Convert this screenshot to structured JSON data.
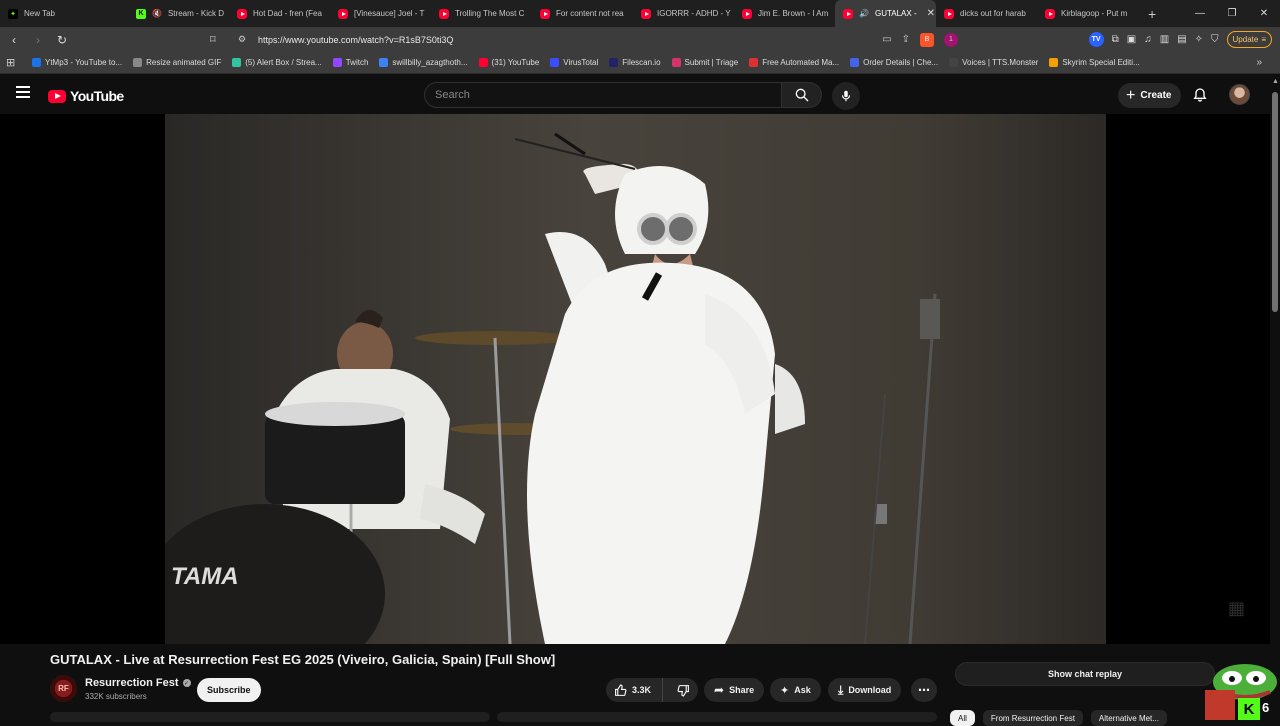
{
  "browser": {
    "tabs": [
      {
        "label": "New Tab",
        "favicon": "brave"
      },
      {
        "label": "Stream - Kick D",
        "favicon": "kick",
        "muted": true
      },
      {
        "label": "Hot Dad - fren (Fea",
        "favicon": "youtube"
      },
      {
        "label": "[Vinesauce] Joel - T",
        "favicon": "youtube"
      },
      {
        "label": "Trolling The Most C",
        "favicon": "youtube"
      },
      {
        "label": "For content not rea",
        "favicon": "youtube"
      },
      {
        "label": "IGORRR - ADHD - Y",
        "favicon": "youtube"
      },
      {
        "label": "Jim E. Brown - I Am",
        "favicon": "youtube"
      },
      {
        "label": "GUTALAX -",
        "favicon": "youtube",
        "active": true,
        "playing": true
      },
      {
        "label": "dicks out for harab",
        "favicon": "youtube"
      },
      {
        "label": "Kirblagoop - Put m",
        "favicon": "youtube"
      }
    ],
    "url": "https://www.youtube.com/watch?v=R1sB7S0ti3Q",
    "brave_shield_count": "1",
    "update_label": "Update",
    "extension_tv_label": "TV",
    "bookmarks": [
      {
        "label": "YtMp3 - YouTube to...",
        "color": "#1a73e8"
      },
      {
        "label": "Resize animated GIF",
        "color": "#888888"
      },
      {
        "label": "(5) Alert Box / Strea...",
        "color": "#31c3a2"
      },
      {
        "label": "Twitch",
        "color": "#9146ff"
      },
      {
        "label": "swillbilly_azagthoth...",
        "color": "#3b82f6"
      },
      {
        "label": "(31) YouTube",
        "color": "#ff0033"
      },
      {
        "label": "VirusTotal",
        "color": "#394eff"
      },
      {
        "label": "Filescan.io",
        "color": "#222266"
      },
      {
        "label": "Submit | Triage",
        "color": "#d6336c"
      },
      {
        "label": "Free Automated Ma...",
        "color": "#e03131"
      },
      {
        "label": "Order Details | Che...",
        "color": "#4263eb"
      },
      {
        "label": "Voices | TTS.Monster",
        "color": "#444444"
      },
      {
        "label": "Skyrim Special Editi...",
        "color": "#f59f00"
      }
    ]
  },
  "youtube": {
    "logo_text": "YouTube",
    "search_placeholder": "Search",
    "create_label": "Create"
  },
  "video": {
    "title": "GUTALAX - Live at Resurrection Fest EG 2025 (Viveiro, Galicia, Spain) [Full Show]",
    "channel": {
      "name": "Resurrection Fest",
      "subscribers": "332K subscribers",
      "avatar_text": "RF"
    },
    "subscribe_label": "Subscribe",
    "likes": "3.3K",
    "share_label": "Share",
    "ask_label": "Ask",
    "download_label": "Download",
    "drum_brand": "TAMA"
  },
  "sidebar": {
    "chat_replay_label": "Show chat replay",
    "chips": [
      "All",
      "From Resurrection Fest",
      "Alternative Met..."
    ]
  },
  "overlay": {
    "kick_count": "6"
  },
  "colors": {
    "youtube_red": "#ff0033",
    "kick_green": "#53fc18",
    "background": "#0f0f0f"
  }
}
